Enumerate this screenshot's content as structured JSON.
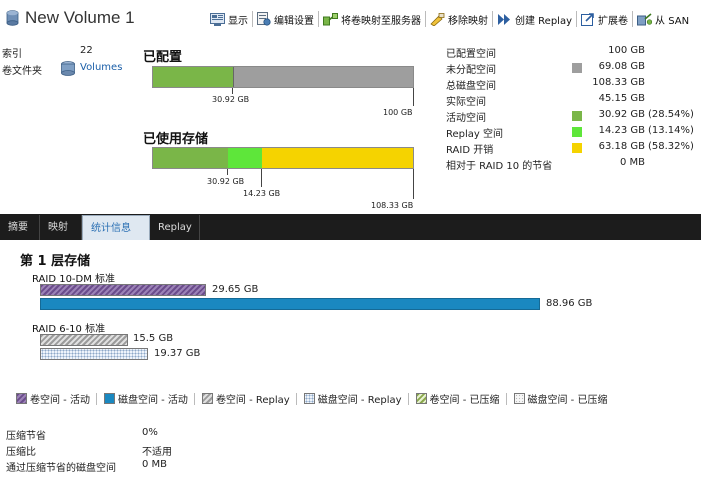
{
  "header": {
    "title": "New Volume 1",
    "toolbar": [
      {
        "label": "显示",
        "icon": "display-icon"
      },
      {
        "label": "编辑设置",
        "icon": "edit-settings-icon"
      },
      {
        "label": "将卷映射至服务器",
        "icon": "map-volume-icon"
      },
      {
        "label": "移除映射",
        "icon": "remove-mapping-icon"
      },
      {
        "label": "创建 Replay",
        "icon": "create-replay-icon"
      },
      {
        "label": "扩展卷",
        "icon": "expand-volume-icon"
      },
      {
        "label": "从 SAN",
        "icon": "from-san-icon"
      }
    ]
  },
  "info": {
    "index_label": "索引",
    "index_value": "22",
    "folder_label": "卷文件夹",
    "folder_value": "Volumes"
  },
  "configured": {
    "title": "已配置",
    "used_label": "30.92 GB",
    "total_label": "100 GB"
  },
  "storage_used": {
    "title": "已使用存储",
    "active_label": "30.92 GB",
    "replay_label": "14.23 GB",
    "total_label": "108.33 GB"
  },
  "stats": [
    {
      "label": "已配置空间",
      "value": "100 GB",
      "pct": "",
      "color": ""
    },
    {
      "label": "未分配空间",
      "value": "69.08 GB",
      "pct": "",
      "color": "#9e9e9e"
    },
    {
      "label": "总磁盘空间",
      "value": "108.33 GB",
      "pct": "",
      "color": ""
    },
    {
      "label": "实际空间",
      "value": "45.15 GB",
      "pct": "",
      "color": ""
    },
    {
      "label": "活动空间",
      "value": "30.92 GB",
      "pct": "(28.54%)",
      "color": "#7ab648"
    },
    {
      "label": "Replay 空间",
      "value": "14.23 GB",
      "pct": "(13.14%)",
      "color": "#5ee63a"
    },
    {
      "label": "RAID 开销",
      "value": "63.18 GB",
      "pct": "(58.32%)",
      "color": "#f5d300"
    },
    {
      "label": "相对于 RAID 10 的节省",
      "value": "0 MB",
      "pct": "",
      "color": ""
    }
  ],
  "tabs": [
    "摘要",
    "映射",
    "统计信息",
    "Replay"
  ],
  "active_tab": 2,
  "tier": {
    "title": "第 1 层存储",
    "raid10_label": "RAID 10-DM 标准",
    "raid10_values": [
      "29.65 GB",
      "88.96 GB"
    ],
    "raid6_label": "RAID 6-10 标准",
    "raid6_values": [
      "15.5 GB",
      "19.37 GB"
    ]
  },
  "legend": [
    {
      "label": "卷空间 - 活动",
      "pattern": "purple-diag"
    },
    {
      "label": "磁盘空间 - 活动",
      "pattern": "solid-blue"
    },
    {
      "label": "卷空间 - Replay",
      "pattern": "gray-diag"
    },
    {
      "label": "磁盘空间 - Replay",
      "pattern": "blue-dots"
    },
    {
      "label": "卷空间 - 已压缩",
      "pattern": "green-diag"
    },
    {
      "label": "磁盘空间 - 已压缩",
      "pattern": "gray-dots"
    }
  ],
  "compression": [
    {
      "label": "压缩节省",
      "value": "0%"
    },
    {
      "label": "压缩比",
      "value": "不适用"
    },
    {
      "label": "通过压缩节省的磁盘空间",
      "value": "0 MB"
    }
  ],
  "colors": {
    "configured_used": "#7ab648",
    "unallocated": "#9e9e9e",
    "active": "#7ab648",
    "replay": "#5ee63a",
    "raid_overhead": "#f5d300",
    "disk_active": "#1a88c0",
    "tab_bg": "#1c1c1c"
  }
}
